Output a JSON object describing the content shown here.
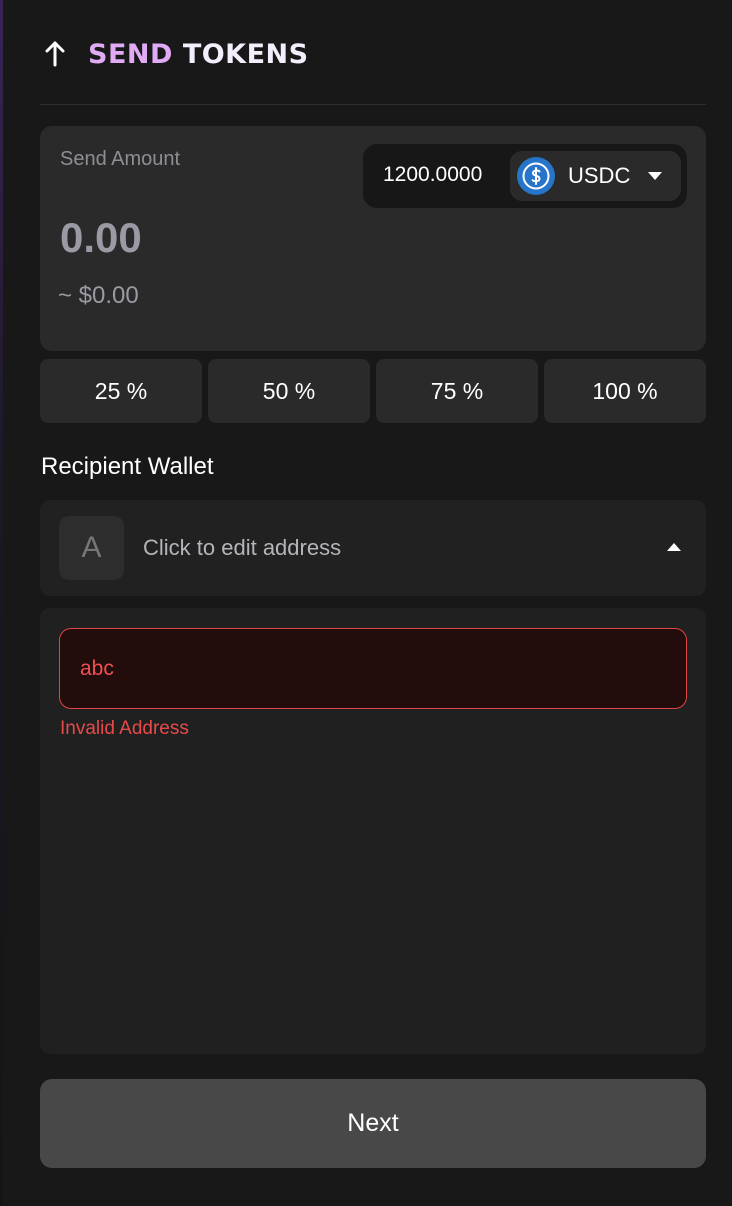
{
  "header": {
    "title_part1": "SEND",
    "title_part2": "TOKENS",
    "icon": "arrow-up-icon"
  },
  "amount": {
    "label": "Send Amount",
    "value": "0.00",
    "usd_value": "~ $0.00",
    "balance": "1200.0000",
    "token": {
      "name": "USDC",
      "icon": "usdc-icon",
      "color": "#2775ca"
    }
  },
  "percent_buttons": [
    "25 %",
    "50 %",
    "75 %",
    "100 %"
  ],
  "recipient": {
    "label": "Recipient Wallet",
    "avatar_letter": "A",
    "address_prompt": "Click to edit address",
    "input_value": "abc",
    "error": "Invalid Address",
    "error_color": "#e84a4a"
  },
  "actions": {
    "next_label": "Next"
  },
  "colors": {
    "background": "#181818",
    "card": "#2a2a2a",
    "title_accent": "#e0aaf5"
  }
}
